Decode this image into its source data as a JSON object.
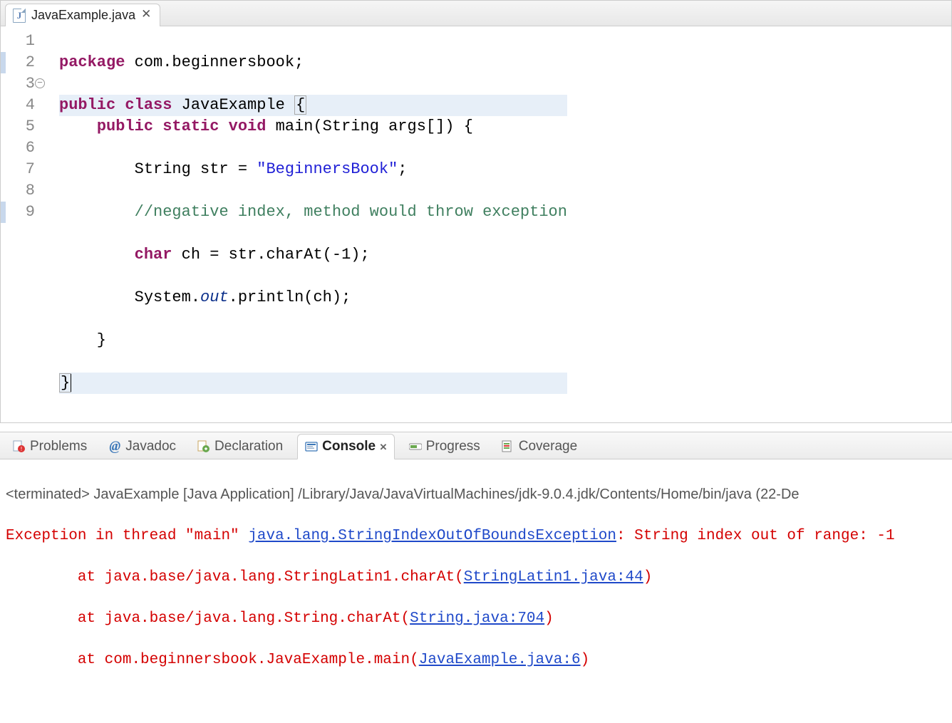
{
  "editorTab": {
    "filename": "JavaExample.java",
    "closeGlyph": "✕"
  },
  "code": {
    "lines": [
      {
        "n": "1"
      },
      {
        "n": "2"
      },
      {
        "n": "3",
        "fold": "−"
      },
      {
        "n": "4"
      },
      {
        "n": "5"
      },
      {
        "n": "6"
      },
      {
        "n": "7"
      },
      {
        "n": "8"
      },
      {
        "n": "9"
      }
    ],
    "l1_kw1": "package",
    "l1_rest": " com.beginnersbook;",
    "l2_kw1": "public",
    "l2_kw2": "class",
    "l2_name": " JavaExample ",
    "l2_brace": "{",
    "l3_indent": "    ",
    "l3_kw1": "public",
    "l3_kw2": "static",
    "l3_kw3": "void",
    "l3_rest": " main(String args[]) {",
    "l4_indent": "        String str = ",
    "l4_str": "\"BeginnersBook\"",
    "l4_semi": ";",
    "l5_indent": "        ",
    "l5_cmt": "//negative index, method would throw exception",
    "l6_indent": "        ",
    "l6_kw": "char",
    "l6_rest": " ch = str.charAt(-1);",
    "l7_indent": "        System.",
    "l7_out": "out",
    "l7_rest": ".println(ch);",
    "l8": "    }",
    "l9": "}"
  },
  "views": {
    "problems": "Problems",
    "javadoc": "Javadoc",
    "declaration": "Declaration",
    "console": "Console",
    "consoleClose": "✕",
    "progress": "Progress",
    "coverage": "Coverage"
  },
  "console": {
    "status": "<terminated> JavaExample [Java Application] /Library/Java/JavaVirtualMachines/jdk-9.0.4.jdk/Contents/Home/bin/java (22-De",
    "exc_prefix": "Exception in thread \"main\" ",
    "exc_type": "java.lang.StringIndexOutOfBoundsException",
    "exc_msg": ": String index out of range: -1",
    "at1_pre": "\tat java.base/java.lang.StringLatin1.charAt(",
    "at1_link": "StringLatin1.java:44",
    "at1_post": ")",
    "at2_pre": "\tat java.base/java.lang.String.charAt(",
    "at2_link": "String.java:704",
    "at2_post": ")",
    "at3_pre": "\tat com.beginnersbook.JavaExample.main(",
    "at3_link": "JavaExample.java:6",
    "at3_post": ")"
  }
}
